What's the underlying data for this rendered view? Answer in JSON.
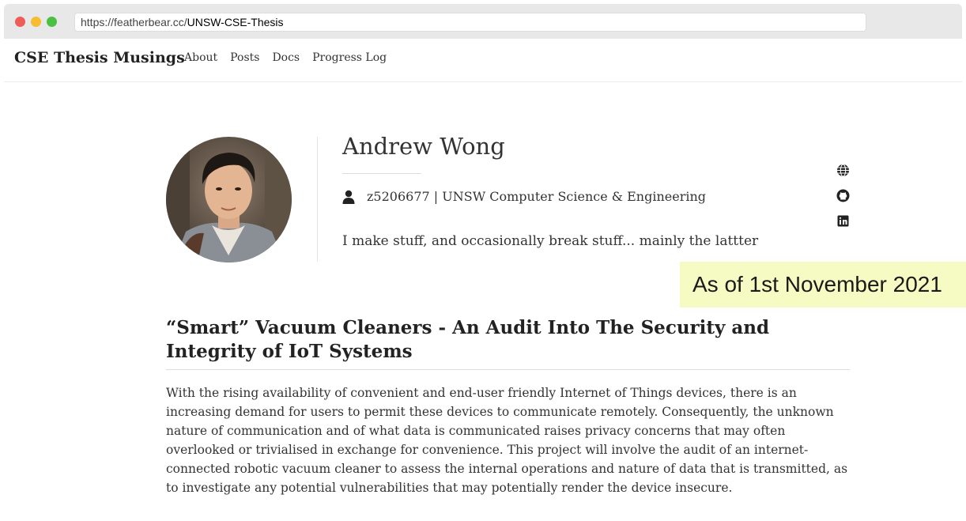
{
  "browser": {
    "url_base": "https://featherbear.cc/",
    "url_path": "UNSW-CSE-Thesis"
  },
  "navbar": {
    "brand": "CSE Thesis Musings",
    "links": [
      "About",
      "Posts",
      "Docs",
      "Progress Log"
    ]
  },
  "profile": {
    "name": "Andrew Wong",
    "id_line": "z5206677 | UNSW Computer Science & Engineering",
    "bio": "I make stuff, and occasionally break stuff... mainly the lattter",
    "social_icons": [
      "globe-icon",
      "github-icon",
      "linkedin-icon"
    ]
  },
  "annotation": {
    "text": "As of 1st November 2021",
    "background": "#f5fbc3"
  },
  "post": {
    "title": "“Smart” Vacuum Cleaners - An Audit Into The Security and Integrity of IoT Systems",
    "body": "With the rising availability of convenient and end-user friendly Internet of Things devices, there is an increasing demand for users to permit these devices to communicate remotely. Consequently, the unknown nature of communication and of what data is communicated raises privacy concerns that may often overlooked or trivialised in exchange for convenience. This project will involve the audit of an internet-connected robotic vacuum cleaner to assess the internal operations and nature of data that is transmitted, as to investigate any potential vulnerabilities that may potentially render the device insecure."
  }
}
